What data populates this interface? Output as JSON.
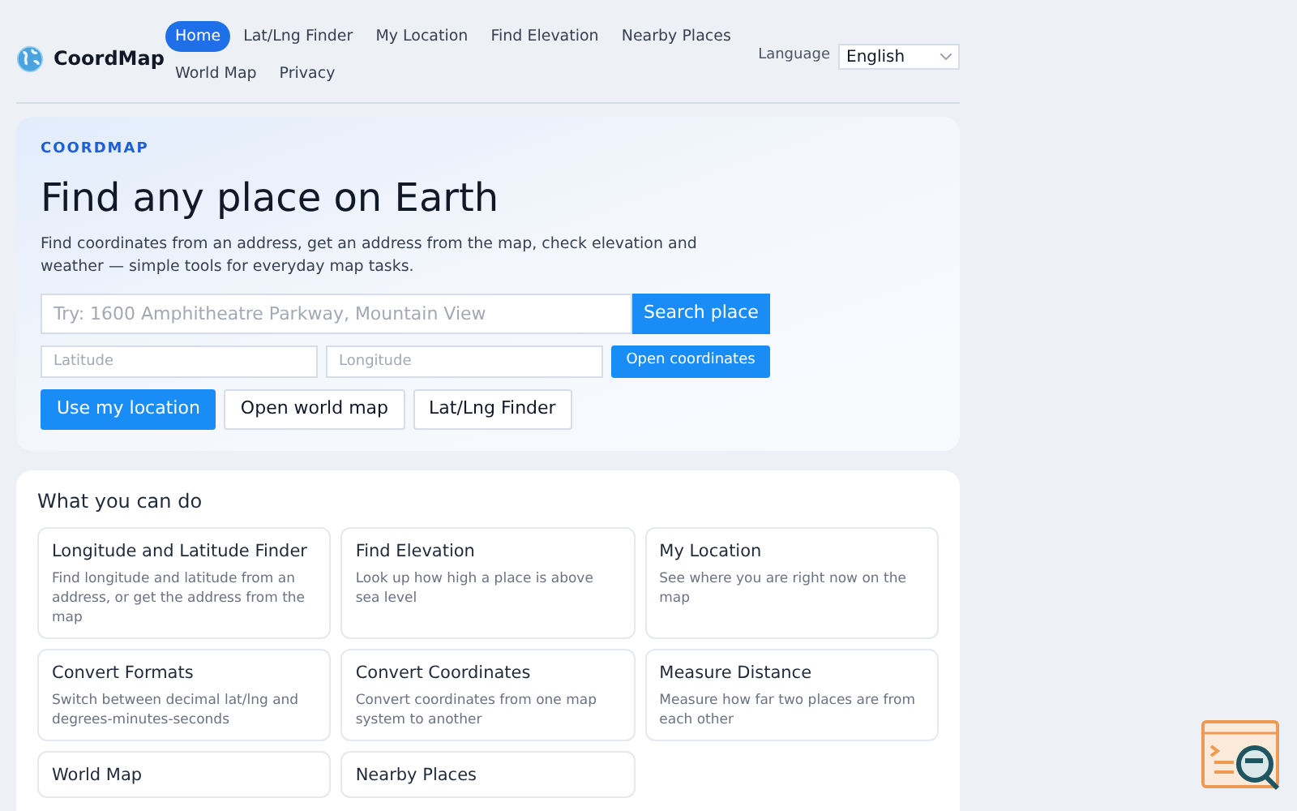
{
  "brand": {
    "name": "CoordMap"
  },
  "nav": [
    {
      "label": "Home",
      "selected": true
    },
    {
      "label": "Lat/Lng Finder",
      "selected": false
    },
    {
      "label": "My Location",
      "selected": false
    },
    {
      "label": "Find Elevation",
      "selected": false
    },
    {
      "label": "Nearby Places",
      "selected": false
    },
    {
      "label": "World Map",
      "selected": false
    },
    {
      "label": "Privacy",
      "selected": false
    }
  ],
  "language": {
    "label": "Language",
    "value": "English"
  },
  "hero": {
    "eyebrow": "COORDMAP",
    "title": "Find any place on Earth",
    "description": "Find coordinates from an address, get an address from the map, check elevation and weather — simple tools for everyday map tasks.",
    "search": {
      "placeholder": "Try: 1600 Amphitheatre Parkway, Mountain View",
      "button": "Search place"
    },
    "latitude": {
      "placeholder": "Latitude"
    },
    "longitude": {
      "placeholder": "Longitude"
    },
    "open_button": "Open coordinates",
    "actions": [
      {
        "label": "Use my location",
        "kind": "primary"
      },
      {
        "label": "Open world map",
        "kind": "secondary"
      },
      {
        "label": "Lat/Lng Finder",
        "kind": "secondary"
      }
    ]
  },
  "features": {
    "title": "What you can do",
    "cards": [
      {
        "title": "Longitude and Latitude Finder",
        "description": "Find longitude and latitude from an address, or get the address from the map"
      },
      {
        "title": "Find Elevation",
        "description": "Look up how high a place is above sea level"
      },
      {
        "title": "My Location",
        "description": "See where you are right now on the map"
      },
      {
        "title": "Convert Formats",
        "description": "Switch between decimal lat/lng and degrees-minutes-seconds"
      },
      {
        "title": "Convert Coordinates",
        "description": "Convert coordinates from one map system to another"
      },
      {
        "title": "Measure Distance",
        "description": "Measure how far two places are from each other"
      },
      {
        "title": "World Map"
      },
      {
        "title": "Nearby Places"
      }
    ]
  }
}
